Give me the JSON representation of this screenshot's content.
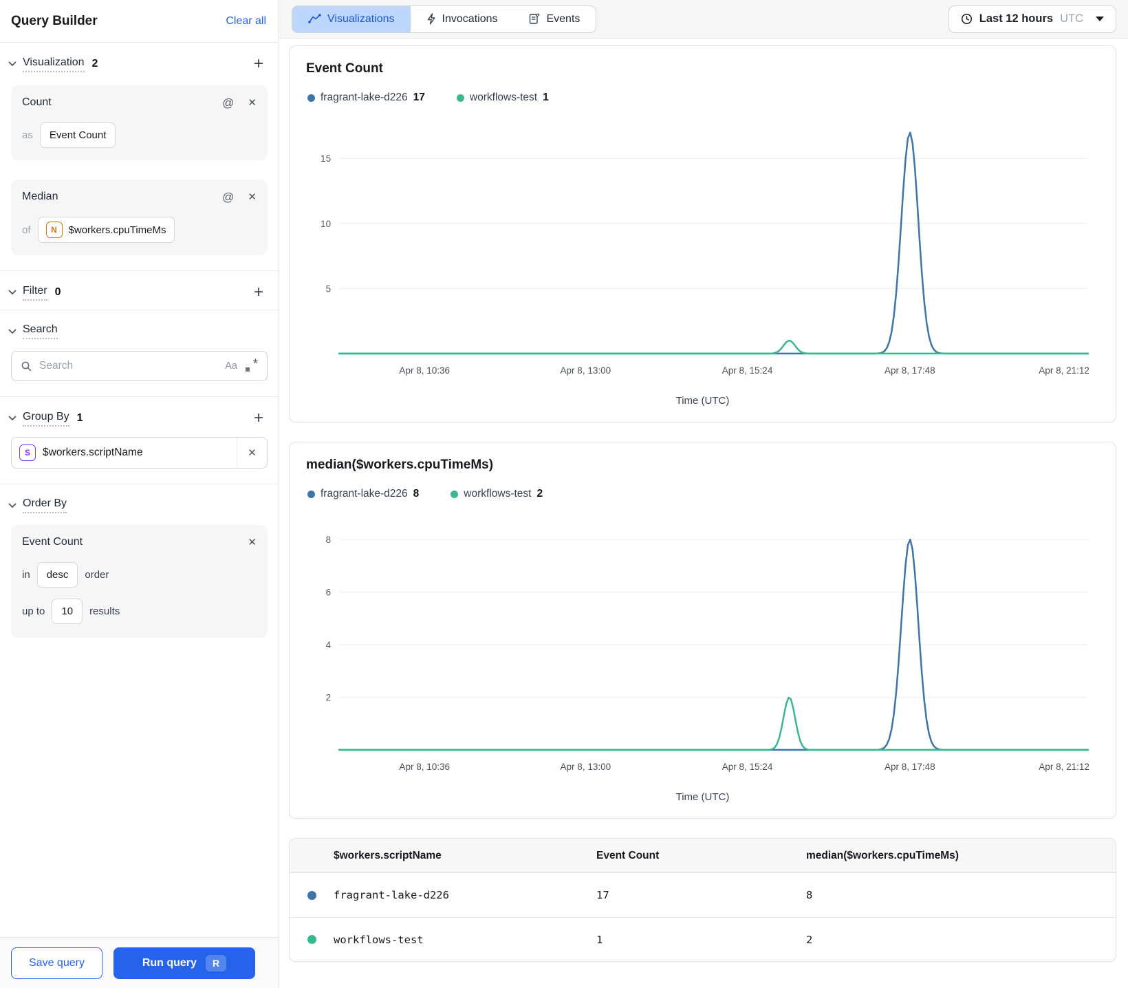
{
  "sidebar": {
    "title": "Query Builder",
    "clear_all": "Clear all",
    "visualization": {
      "label": "Visualization",
      "count": "2",
      "cards": [
        {
          "title": "Count",
          "prefix": "as",
          "alias": "Event Count"
        },
        {
          "title": "Median",
          "prefix": "of",
          "field_type_icon": "N",
          "field": "$workers.cpuTimeMs"
        }
      ]
    },
    "filter": {
      "label": "Filter",
      "count": "0"
    },
    "search": {
      "label": "Search",
      "placeholder": "Search",
      "match_case_icon": "Aa"
    },
    "group_by": {
      "label": "Group By",
      "count": "1",
      "chip": {
        "type_icon": "S",
        "field": "$workers.scriptName"
      }
    },
    "order_by": {
      "label": "Order By",
      "card": {
        "title": "Event Count",
        "in_label": "in",
        "direction": "desc",
        "order_label": "order",
        "up_to_label": "up to",
        "limit": "10",
        "results_label": "results"
      }
    },
    "footer": {
      "save": "Save query",
      "run": "Run query",
      "run_shortcut": "R"
    }
  },
  "header": {
    "tabs": [
      {
        "label": "Visualizations",
        "active": true
      },
      {
        "label": "Invocations",
        "active": false
      },
      {
        "label": "Events",
        "active": false
      }
    ],
    "time_range": {
      "label": "Last 12 hours",
      "timezone": "UTC"
    }
  },
  "colors": {
    "accent_blue": "#2563eb",
    "active_tab_bg": "#bcd7fb",
    "series_blue": "#3e74a7",
    "series_green": "#38b98b"
  },
  "chart_data": [
    {
      "type": "line",
      "title": "Event Count",
      "xlabel": "Time (UTC)",
      "x_ticks": [
        "Apr 8, 10:36",
        "Apr 8, 13:00",
        "Apr 8, 15:24",
        "Apr 8, 17:48",
        "Apr 8, 21:12"
      ],
      "x_tick_fractions": [
        0.114,
        0.329,
        0.545,
        0.762,
        0.968
      ],
      "y_ticks": [
        5,
        10,
        15
      ],
      "y_max": 17.6,
      "grid": true,
      "legend_position": "top",
      "series": [
        {
          "name": "fragrant-lake-d226",
          "color": "#3e74a7",
          "legend_value": "17",
          "baseline": 0,
          "spikes": [
            {
              "center": 0.762,
              "width": 0.016,
              "peak": 17,
              "peak_time": "Apr 8, ~17:50"
            }
          ]
        },
        {
          "name": "workflows-test",
          "color": "#38b98b",
          "legend_value": "1",
          "baseline": 0,
          "spikes": [
            {
              "center": 0.601,
              "width": 0.011,
              "peak": 1,
              "peak_time": "Apr 8, ~15:40"
            }
          ]
        }
      ]
    },
    {
      "type": "line",
      "title": "median($workers.cpuTimeMs)",
      "xlabel": "Time (UTC)",
      "x_ticks": [
        "Apr 8, 10:36",
        "Apr 8, 13:00",
        "Apr 8, 15:24",
        "Apr 8, 17:48",
        "Apr 8, 21:12"
      ],
      "x_tick_fractions": [
        0.114,
        0.329,
        0.545,
        0.762,
        0.968
      ],
      "y_ticks": [
        2,
        4,
        6,
        8
      ],
      "y_max": 8.7,
      "grid": true,
      "legend_position": "top",
      "series": [
        {
          "name": "fragrant-lake-d226",
          "color": "#3e74a7",
          "legend_value": "8",
          "baseline": 0,
          "spikes": [
            {
              "center": 0.762,
              "width": 0.016,
              "peak": 8,
              "peak_time": "Apr 8, ~17:50"
            }
          ]
        },
        {
          "name": "workflows-test",
          "color": "#38b98b",
          "legend_value": "2",
          "baseline": 0,
          "spikes": [
            {
              "center": 0.601,
              "width": 0.011,
              "peak": 2,
              "peak_time": "Apr 8, ~15:40"
            }
          ]
        }
      ]
    }
  ],
  "table": {
    "columns": [
      "$workers.scriptName",
      "Event Count",
      "median($workers.cpuTimeMs)"
    ],
    "rows": [
      {
        "dot_color": "#3e74a7",
        "script_name": "fragrant-lake-d226",
        "event_count": "17",
        "median": "8"
      },
      {
        "dot_color": "#38b98b",
        "script_name": "workflows-test",
        "event_count": "1",
        "median": "2"
      }
    ]
  }
}
